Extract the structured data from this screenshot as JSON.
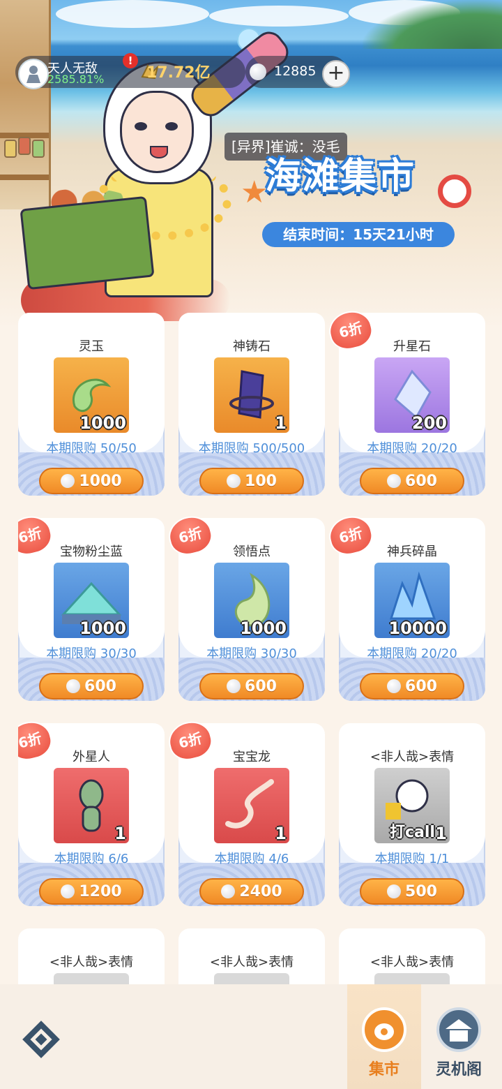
{
  "header": {
    "rank_name": "天人无敌",
    "rank_percent": "2585.81%",
    "alert_mark": "!",
    "gold": "17.72亿",
    "pearls": "12885",
    "add_symbol": "+"
  },
  "event": {
    "speaker_label": "[异界]崔诚：没毛",
    "title": "海滩集市",
    "end_time": "结束时间：15天21小时"
  },
  "items": [
    {
      "name": "灵玉",
      "qty": "1000",
      "limit": "本期限购 50/50",
      "price": "1000",
      "badge": ""
    },
    {
      "name": "神铸石",
      "qty": "1",
      "limit": "本期限购 500/500",
      "price": "100",
      "badge": ""
    },
    {
      "name": "升星石",
      "qty": "200",
      "limit": "本期限购 20/20",
      "price": "600",
      "badge": "6折"
    },
    {
      "name": "宝物粉尘蓝",
      "qty": "1000",
      "limit": "本期限购 30/30",
      "price": "600",
      "badge": "6折"
    },
    {
      "name": "领悟点",
      "qty": "1000",
      "limit": "本期限购 30/30",
      "price": "600",
      "badge": "6折"
    },
    {
      "name": "神兵碎晶",
      "qty": "10000",
      "limit": "本期限购 20/20",
      "price": "600",
      "badge": "6折"
    },
    {
      "name": "外星人",
      "qty": "1",
      "limit": "本期限购 6/6",
      "price": "1200",
      "badge": "6折"
    },
    {
      "name": "宝宝龙",
      "qty": "1",
      "limit": "本期限购 4/6",
      "price": "2400",
      "badge": "6折"
    },
    {
      "name": "<非人哉>表情",
      "qty": "1",
      "limit": "本期限购 1/1",
      "price": "500",
      "badge": "",
      "sticker_text": "打call"
    },
    {
      "name": "<非人哉>表情",
      "qty": "",
      "limit": "",
      "price": "",
      "badge": ""
    },
    {
      "name": "<非人哉>表情",
      "qty": "",
      "limit": "",
      "price": "",
      "badge": ""
    },
    {
      "name": "<非人哉>表情",
      "qty": "",
      "limit": "",
      "price": "",
      "badge": ""
    }
  ],
  "nav": {
    "market_label": "集市",
    "lingji_label": "灵机阁"
  },
  "colors": {
    "accent_orange": "#f08a26",
    "limit_blue": "#4f8fd9",
    "badge_red": "#e94e3f",
    "title_blue": "#2d7cd6"
  }
}
